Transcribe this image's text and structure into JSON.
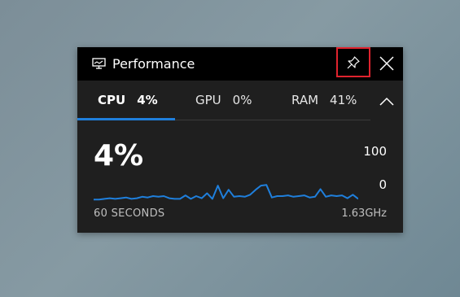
{
  "window": {
    "title": "Performance",
    "icons": {
      "title": "monitor-icon",
      "pin": "pin-icon",
      "close": "close-icon",
      "collapse": "chevron-up-icon"
    }
  },
  "tabs": [
    {
      "label": "CPU",
      "value": "4%"
    },
    {
      "label": "GPU",
      "value": "0%"
    },
    {
      "label": "RAM",
      "value": "41%"
    }
  ],
  "active_tab": "CPU",
  "graph": {
    "current": "4%",
    "axis_max": "100",
    "axis_min": "0",
    "duration": "60 SECONDS",
    "clock": "1.63GHz",
    "color": "#1f7fdc",
    "samples": [
      2,
      2,
      3,
      4,
      3,
      4,
      5,
      3,
      4,
      6,
      5,
      7,
      6,
      7,
      4,
      3,
      3,
      8,
      3,
      7,
      4,
      11,
      3,
      22,
      4,
      16,
      6,
      7,
      6,
      9,
      16,
      22,
      23,
      5,
      7,
      7,
      8,
      6,
      7,
      8,
      5,
      6,
      17,
      6,
      8,
      7,
      8,
      4,
      9,
      3
    ]
  }
}
